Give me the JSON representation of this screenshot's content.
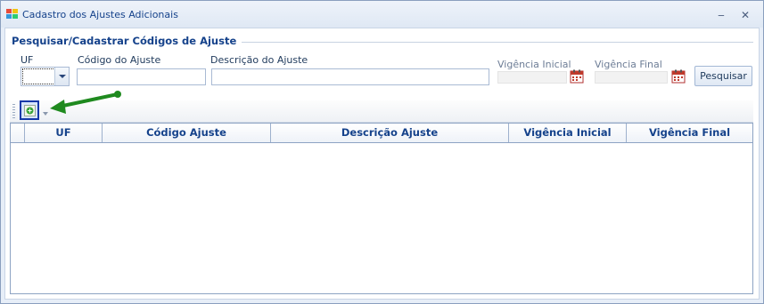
{
  "window": {
    "title": "Cadastro dos Ajustes Adicionais",
    "minimize": "‒",
    "close": "✕"
  },
  "group": {
    "title": "Pesquisar/Cadastrar Códigos de Ajuste"
  },
  "form": {
    "uf_label": "UF",
    "codigo_label": "Código do Ajuste",
    "descricao_label": "Descrição do Ajuste",
    "vig_inicial_label": "Vigência Inicial",
    "vig_final_label": "Vigência Final",
    "uf_value": "",
    "codigo_value": "",
    "descricao_value": "",
    "vig_inicial_value": "",
    "vig_final_value": "",
    "search_button": "Pesquisar"
  },
  "grid": {
    "columns": [
      "UF",
      "Código Ajuste",
      "Descrição Ajuste",
      "Vigência Inicial",
      "Vigência Final"
    ],
    "rows": []
  },
  "icons": {
    "app": "app-window-icon",
    "calendar": "calendar-icon",
    "add": "add-record-icon",
    "annotation": "green-pointer-arrow"
  },
  "colors": {
    "accent": "#15428b",
    "highlight_border": "#1438a8",
    "annotation_arrow": "#1f8a1f",
    "calendar": "#c0392b"
  }
}
